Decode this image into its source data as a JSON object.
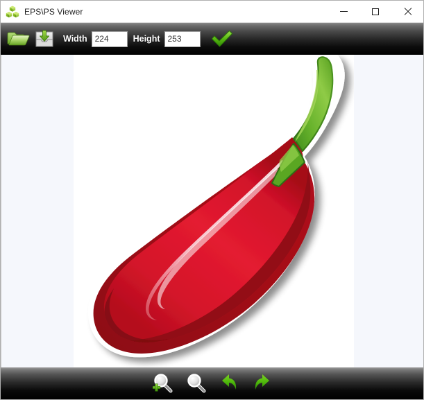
{
  "window": {
    "title": "EPS\\PS Viewer",
    "app_icon": "green-cubes-icon"
  },
  "window_controls": {
    "minimize_label": "Minimize",
    "maximize_label": "Maximize",
    "close_label": "Close"
  },
  "toolbar_top": {
    "open_button": {
      "name": "open-file-button",
      "icon": "open-folder-icon",
      "tooltip": "Open"
    },
    "save_button": {
      "name": "save-file-button",
      "icon": "save-disk-icon",
      "tooltip": "Save"
    },
    "width": {
      "label": "Width",
      "value": "224",
      "placeholder": "Width"
    },
    "height": {
      "label": "Height",
      "value": "253",
      "placeholder": "Height"
    },
    "apply_button": {
      "name": "apply-button",
      "icon": "green-check-icon",
      "tooltip": "Apply"
    }
  },
  "toolbar_bottom": {
    "zoom_in": {
      "icon": "zoom-in-magnifier-icon",
      "tooltip": "Zoom In"
    },
    "zoom_out": {
      "icon": "zoom-out-magnifier-icon",
      "tooltip": "Zoom Out"
    },
    "rotate_left": {
      "icon": "rotate-left-arrow-icon",
      "tooltip": "Rotate Left"
    },
    "rotate_right": {
      "icon": "rotate-right-arrow-icon",
      "tooltip": "Rotate Right"
    }
  },
  "canvas": {
    "background_color": "#f5f7fc",
    "sheet_color": "#ffffff",
    "image_name": "red-chili-pepper-illustration",
    "image_alt": "Red chili pepper with green stem"
  },
  "colors": {
    "pepper_body": "#e0162b",
    "pepper_bright": "#e8202f",
    "pepper_dark": "#9d0b18",
    "pepper_shadow": "#7e0712",
    "pepper_highlight": "#f28a97",
    "stem_green": "#4f9a2a",
    "stem_light": "#8cc63f",
    "accent_green": "#5cb811",
    "toolbar_dark": "#000000",
    "titlebar_bg": "#ffffff"
  }
}
